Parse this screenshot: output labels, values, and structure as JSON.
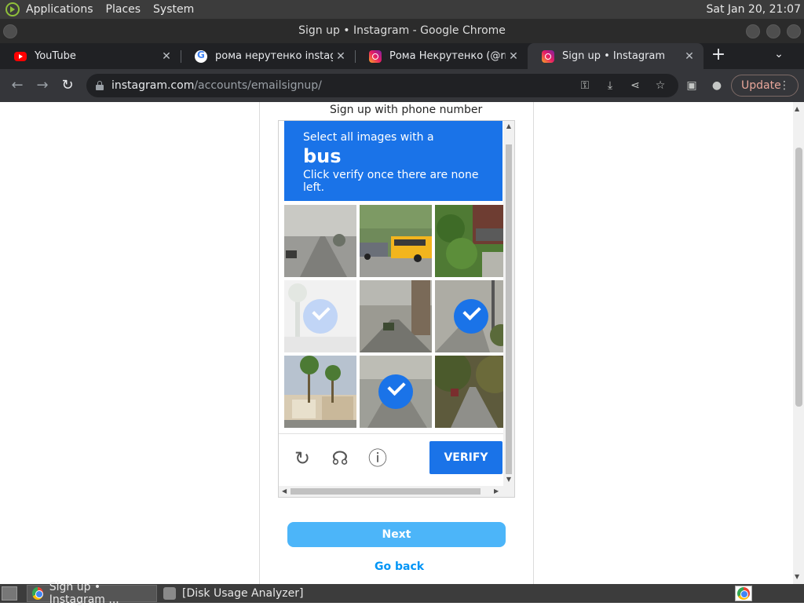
{
  "panel": {
    "menus": [
      "Applications",
      "Places",
      "System"
    ],
    "clock": "Sat Jan 20, 21:07"
  },
  "window": {
    "title": "Sign up • Instagram - Google Chrome"
  },
  "tabs": [
    {
      "title": "YouTube",
      "favicon": "youtube-icon"
    },
    {
      "title": "рома нерутенко instagram",
      "favicon": "google-icon"
    },
    {
      "title": "Рома Некрутенко (@rnek",
      "favicon": "instagram-icon"
    },
    {
      "title": "Sign up • Instagram",
      "favicon": "instagram-icon",
      "active": true
    }
  ],
  "omnibox": {
    "host": "instagram.com",
    "path": "/accounts/emailsignup/"
  },
  "toolbar": {
    "update_label": "Update"
  },
  "page": {
    "phone_signup_link": "Sign up with phone number",
    "next_label": "Next",
    "go_back_label": "Go back"
  },
  "captcha": {
    "instruction": "Select all images with a",
    "target": "bus",
    "hint": "Click verify once there are none left.",
    "verify_label": "VERIFY",
    "accent": "#1a73e8",
    "tiles": [
      {
        "scene": "road-gray",
        "selected": false
      },
      {
        "scene": "school-bus",
        "selected": false
      },
      {
        "scene": "green-leaves",
        "selected": false
      },
      {
        "scene": "palm-faded",
        "selected": true,
        "fading": true
      },
      {
        "scene": "tower-street",
        "selected": false
      },
      {
        "scene": "pole-street",
        "selected": true
      },
      {
        "scene": "palm-building",
        "selected": false
      },
      {
        "scene": "gray-street",
        "selected": true
      },
      {
        "scene": "tree-road",
        "selected": false
      }
    ]
  },
  "taskbar": {
    "tasks": [
      {
        "label": "Sign up • Instagram ...",
        "icon": "chrome-icon"
      },
      {
        "label": "[Disk Usage Analyzer]",
        "icon": "disk-usage-icon"
      }
    ]
  }
}
